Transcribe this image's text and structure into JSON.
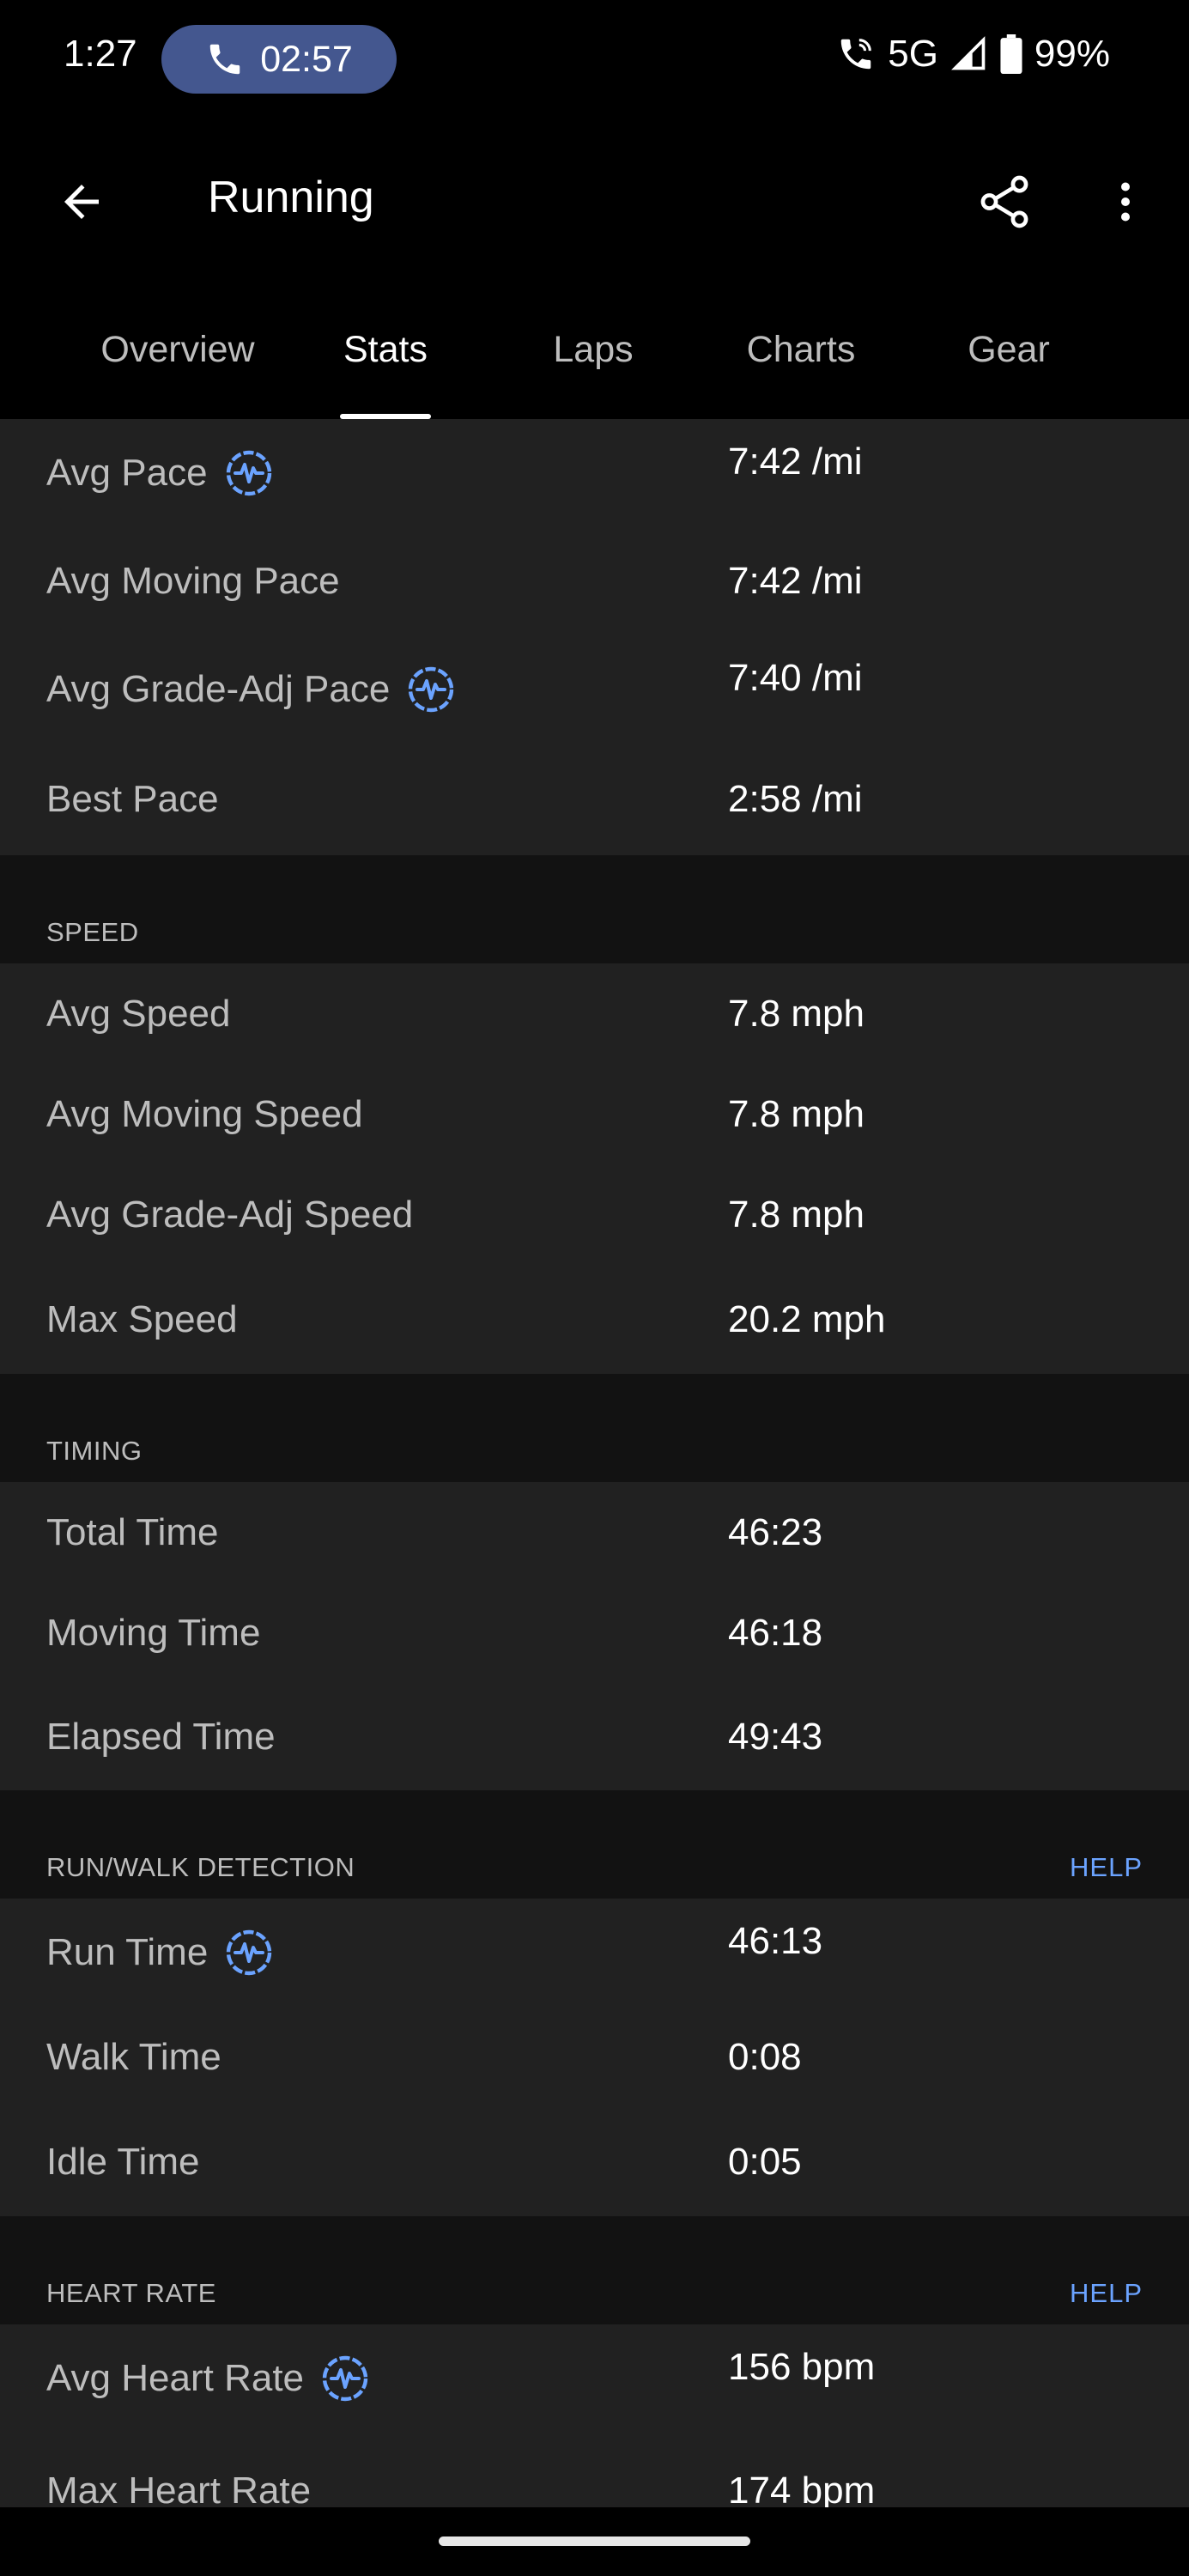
{
  "status_bar": {
    "time": "1:27",
    "call_timer": "02:57",
    "network": "5G",
    "battery": "99%"
  },
  "app_bar": {
    "title": "Running"
  },
  "tabs": [
    {
      "label": "Overview",
      "active": false
    },
    {
      "label": "Stats",
      "active": true
    },
    {
      "label": "Laps",
      "active": false
    },
    {
      "label": "Charts",
      "active": false
    },
    {
      "label": "Gear",
      "active": false
    }
  ],
  "pace": {
    "rows": [
      {
        "label": "Avg Pace",
        "value": "7:42 /mi",
        "badge": "wave-badge-icon"
      },
      {
        "label": "Avg Moving Pace",
        "value": "7:42 /mi"
      },
      {
        "label": "Avg Grade-Adj Pace",
        "value": "7:40 /mi",
        "badge": "wave-badge-icon"
      },
      {
        "label": "Best Pace",
        "value": "2:58 /mi"
      }
    ]
  },
  "speed": {
    "title": "SPEED",
    "rows": [
      {
        "label": "Avg Speed",
        "value": "7.8 mph"
      },
      {
        "label": "Avg Moving Speed",
        "value": "7.8 mph"
      },
      {
        "label": "Avg Grade-Adj Speed",
        "value": "7.8 mph"
      },
      {
        "label": "Max Speed",
        "value": "20.2 mph"
      }
    ]
  },
  "timing": {
    "title": "TIMING",
    "rows": [
      {
        "label": "Total Time",
        "value": "46:23"
      },
      {
        "label": "Moving Time",
        "value": "46:18"
      },
      {
        "label": "Elapsed Time",
        "value": "49:43"
      }
    ]
  },
  "run_walk": {
    "title": "RUN/WALK DETECTION",
    "help": "HELP",
    "rows": [
      {
        "label": "Run Time",
        "value": "46:13",
        "badge": "wave-badge-icon"
      },
      {
        "label": "Walk Time",
        "value": "0:08"
      },
      {
        "label": "Idle Time",
        "value": "0:05"
      }
    ]
  },
  "heart_rate": {
    "title": "HEART RATE",
    "help": "HELP",
    "rows": [
      {
        "label": "Avg Heart Rate",
        "value": "156 bpm",
        "badge": "wave-badge-icon"
      },
      {
        "label": "Max Heart Rate",
        "value": "174 bpm"
      }
    ]
  },
  "colors": {
    "accent": "#6ba3ff",
    "call_pill": "#44578f",
    "card_bg": "#212121",
    "header_bg": "#121212"
  }
}
